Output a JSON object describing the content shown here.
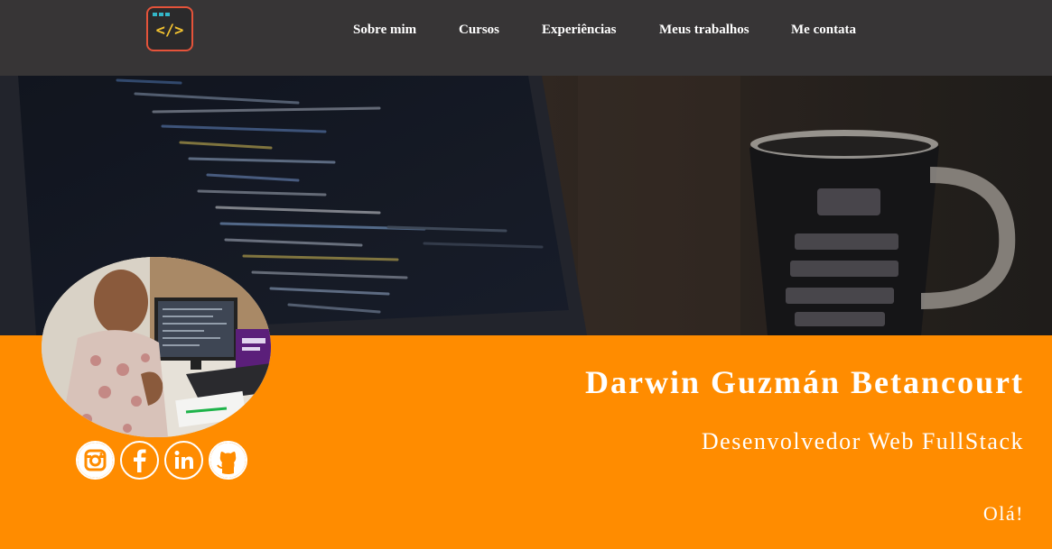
{
  "nav": {
    "logo_text": "</>",
    "links": [
      "Sobre mim",
      "Cursos",
      "Experiências",
      "Meus trabalhos",
      "Me contata"
    ]
  },
  "profile": {
    "name": "Darwin Guzmán Betancourt",
    "role": "Desenvolvedor Web FullStack",
    "greeting": "Olá!"
  },
  "social": [
    {
      "icon": "instagram-icon"
    },
    {
      "icon": "facebook-icon"
    },
    {
      "icon": "linkedin-icon"
    },
    {
      "icon": "github-icon"
    }
  ],
  "colors": {
    "nav_bg": "#373536",
    "accent_orange": "#ff8c00",
    "logo_border": "#e5533a",
    "text_white": "#ffffff"
  }
}
